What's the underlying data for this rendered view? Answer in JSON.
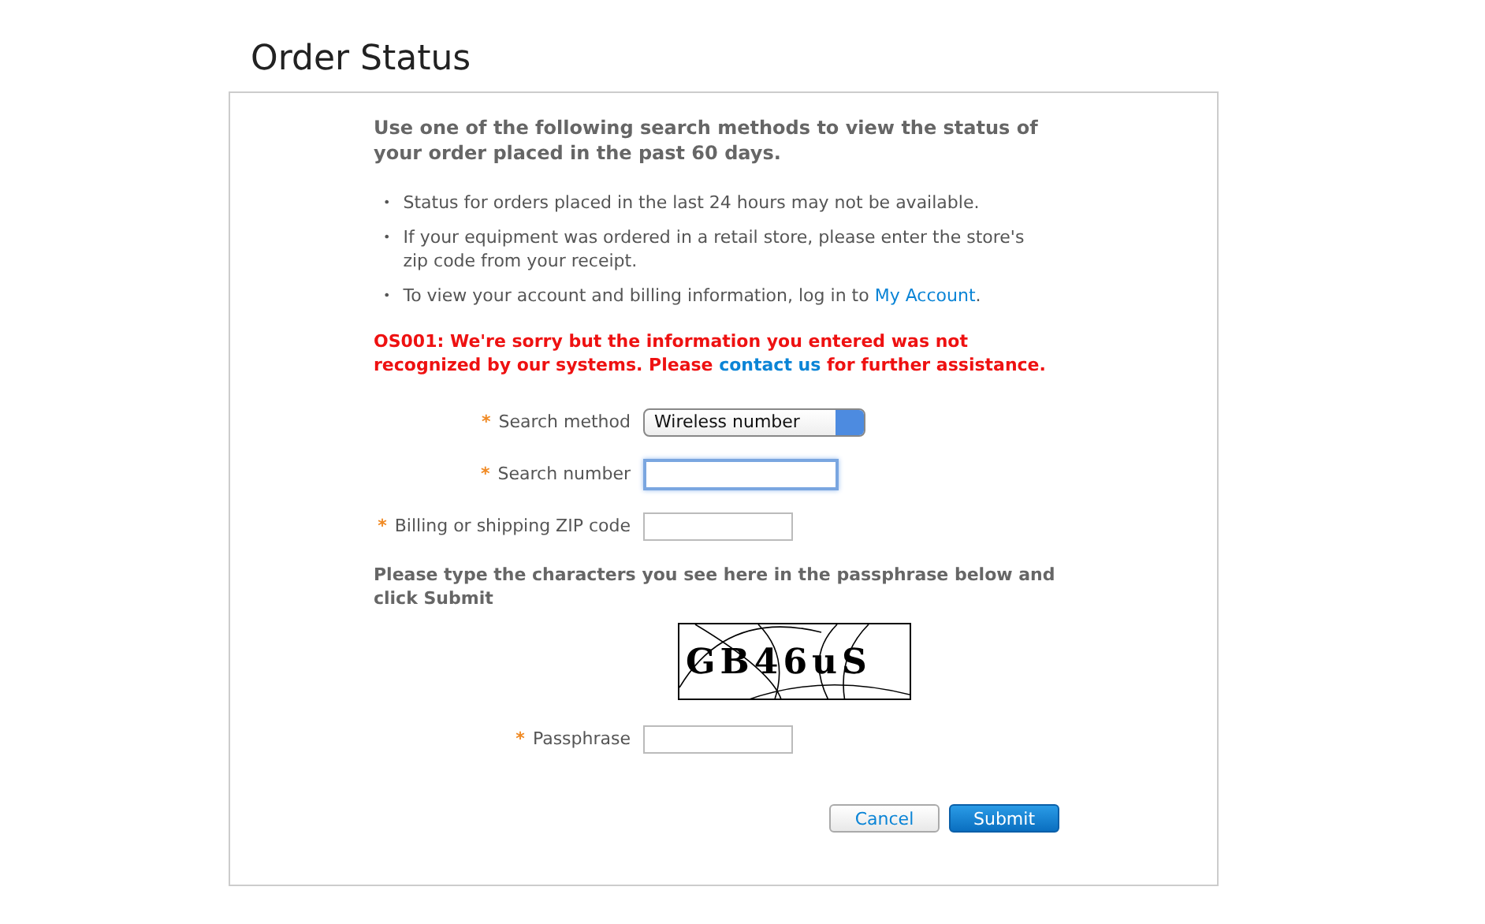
{
  "title": "Order Status",
  "intro": "Use one of the following search methods to view the status of your order placed in the past 60 days.",
  "bullet": "•",
  "notes": [
    {
      "text": "Status for orders placed in the last 24 hours may not be available."
    },
    {
      "text": "If your equipment was ordered in a retail store, please enter the store's zip code from your receipt."
    },
    {
      "text": "To view your account and billing information, log in to",
      "link": "My Account",
      "after": "."
    }
  ],
  "error": {
    "text": "OS001: We're sorry but the information you entered was not recognized by our systems. Please",
    "link": "contact us",
    "after": "for further assistance."
  },
  "fields": [
    {
      "kind": "select",
      "marker": "*",
      "label": "Search method",
      "value": "Wireless number"
    },
    {
      "kind": "text",
      "marker": "*",
      "label": "Search number",
      "focused": true
    },
    {
      "kind": "text",
      "marker": "*",
      "label": "Billing or shipping ZIP code",
      "focused": false
    }
  ],
  "captcha_prompt": "Please type the characters you see here in the passphrase below and click Submit",
  "captcha": {
    "text": "GB46uS"
  },
  "passphrase": {
    "kind": "text",
    "marker": "*",
    "label": "Passphrase",
    "focused": false
  },
  "buttons": [
    {
      "label": "Cancel",
      "primary": false
    },
    {
      "label": "Submit",
      "primary": true
    }
  ]
}
